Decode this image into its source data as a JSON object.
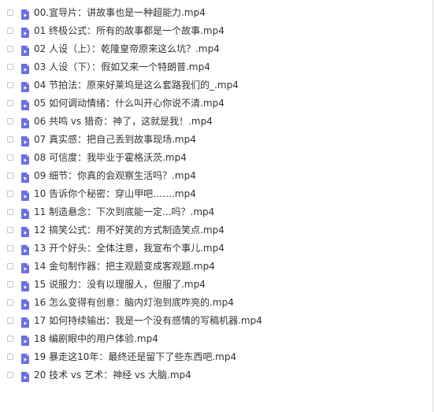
{
  "file_list": {
    "items": [
      {
        "name": "00.宣导片：讲故事也是一种超能力.mp4"
      },
      {
        "name": "01 终极公式：所有的故事都是一个故事.mp4"
      },
      {
        "name": "02 人设（上）：乾隆皇帝原来这么坑？.mp4"
      },
      {
        "name": "03 人设（下）：假如又来一个特朗普.mp4"
      },
      {
        "name": "04 节拍法：原来好莱坞是这么套路我们的_.mp4"
      },
      {
        "name": "05 如何调动情绪：什么叫开心你说不清.mp4"
      },
      {
        "name": "06 共鸣 vs 猎奇：神了，这就是我！.mp4"
      },
      {
        "name": "07 真实感：把自己丢到故事现场.mp4"
      },
      {
        "name": "08 可信度：我毕业于霍格沃茨.mp4"
      },
      {
        "name": "09 细节：你真的会观察生活吗？.mp4"
      },
      {
        "name": "10 告诉你个秘密：穿山甲吧…….mp4"
      },
      {
        "name": "11 制造悬念：下次到底能一定...吗？.mp4"
      },
      {
        "name": "12 搞笑公式：用不好笑的方式制造笑点.mp4"
      },
      {
        "name": "13 开个好头：全体注意，我宣布个事儿.mp4"
      },
      {
        "name": "14 金句制作器：把主观题变成客观题.mp4"
      },
      {
        "name": "15 说服力：没有以理服人，但服了.mp4"
      },
      {
        "name": "16 怎么变得有创意：脑内灯泡到底咋亮的.mp4"
      },
      {
        "name": "17 如何持续输出：我是一个没有感情的写稿机器.mp4"
      },
      {
        "name": "18 编剧眼中的用户体验.mp4"
      },
      {
        "name": "19 暴走这10年：最终还是留下了些东西吧.mp4"
      },
      {
        "name": "20 技术 vs 艺术：神经 vs 大脑.mp4"
      }
    ]
  },
  "colors": {
    "icon": "#6b6ee6",
    "text": "#333333",
    "checkbox_border": "#c7c7c7"
  },
  "icons": {
    "file": "video-file-icon"
  }
}
